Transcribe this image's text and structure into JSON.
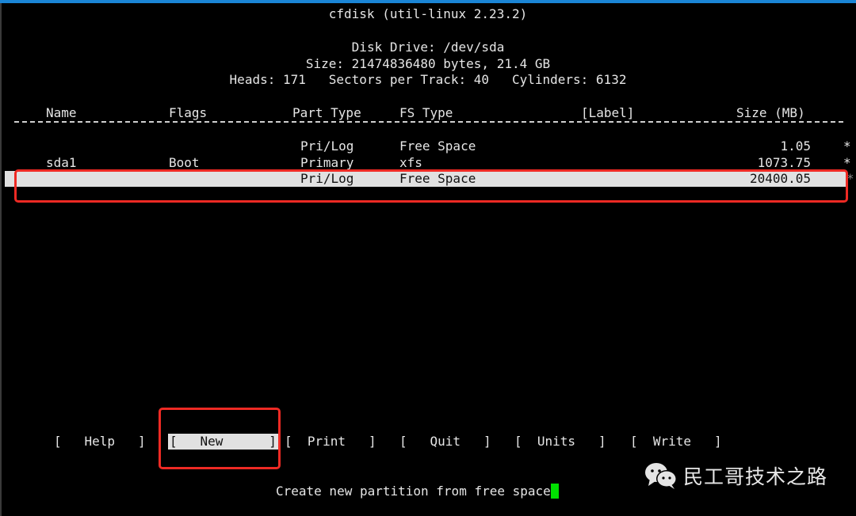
{
  "window": {
    "accent_color": "#1a85d6"
  },
  "header": {
    "title": "cfdisk (util-linux 2.23.2)",
    "disk_drive": "Disk Drive: /dev/sda",
    "size": "Size: 21474836480 bytes, 21.4 GB",
    "geometry": "Heads: 171   Sectors per Track: 40   Cylinders: 6132"
  },
  "table": {
    "columns": [
      "Name",
      "Flags",
      "Part Type",
      "FS Type",
      "[Label]",
      "Size (MB)"
    ],
    "rows": [
      {
        "name": "",
        "flags": "",
        "part_type": "Pri/Log",
        "fs_type": "Free Space",
        "label": "",
        "size": "1.05",
        "marker": "*",
        "selected": false
      },
      {
        "name": "sda1",
        "flags": "Boot",
        "part_type": "Primary",
        "fs_type": "xfs",
        "label": "",
        "size": "1073.75",
        "marker": "*",
        "selected": false
      },
      {
        "name": "",
        "flags": "",
        "part_type": "Pri/Log",
        "fs_type": "Free Space",
        "label": "",
        "size": "20400.05",
        "marker": "*",
        "selected": true
      }
    ]
  },
  "menu": {
    "items": [
      {
        "label": "[   Help   ]",
        "active": false
      },
      {
        "label": "[   New      ]",
        "active": true
      },
      {
        "label": "[  Print   ]",
        "active": false
      },
      {
        "label": "[   Quit   ]",
        "active": false
      },
      {
        "label": "[  Units   ]",
        "active": false
      },
      {
        "label": "[  Write   ]",
        "active": false
      }
    ]
  },
  "status": {
    "text": "Create new partition from free space",
    "cursor_color": "#00e000"
  },
  "annotations": {
    "highlight_color": "#ee2a24"
  },
  "watermark": {
    "icon": "wechat-icon",
    "text": "民工哥技术之路"
  }
}
